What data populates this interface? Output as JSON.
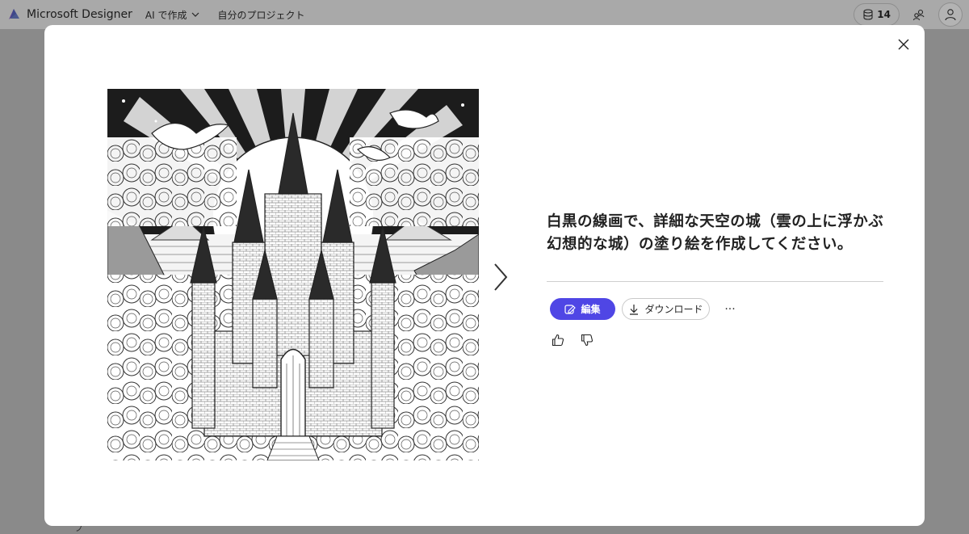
{
  "appbar": {
    "brand": "Microsoft Designer",
    "nav_create": "AI で作成",
    "nav_projects": "自分のプロジェクト",
    "credits": "14"
  },
  "backdrop": {
    "hint": "プ"
  },
  "modal": {
    "prompt": "白黒の線画で、詳細な天空の城（雲の上に浮かぶ幻想的な城）の塗り絵を作成してください。",
    "edit_label": "編集",
    "download_label": "ダウンロード",
    "more_label": "···"
  },
  "icons": {
    "brand": "designer-logo-icon",
    "credits": "coin-stack-icon",
    "tool": "people-icon",
    "avatar": "person-icon",
    "close": "close-icon",
    "next": "chevron-right-icon",
    "edit": "edit-image-icon",
    "download": "download-icon",
    "like": "thumbs-up-icon",
    "dislike": "thumbs-down-icon"
  },
  "colors": {
    "accent": "#4f46e5",
    "overlay": "#8a8a8a"
  }
}
